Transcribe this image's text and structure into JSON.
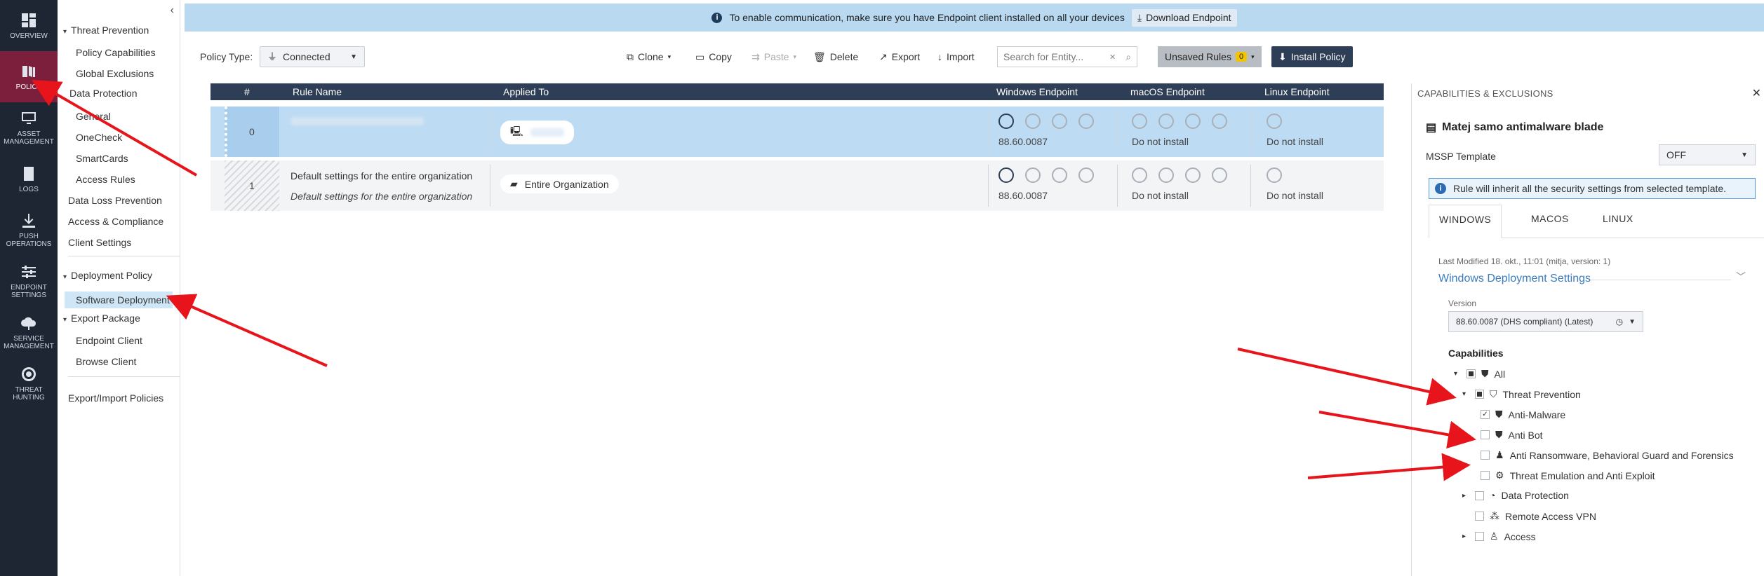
{
  "rail": [
    {
      "label": "OVERVIEW",
      "icon": "grid-icon"
    },
    {
      "label": "POLICY",
      "icon": "policy-icon",
      "active": true
    },
    {
      "label": "ASSET\nMANAGEMENT",
      "icon": "monitor-icon"
    },
    {
      "label": "LOGS",
      "icon": "logs-icon"
    },
    {
      "label": "PUSH\nOPERATIONS",
      "icon": "download-icon"
    },
    {
      "label": "ENDPOINT\nSETTINGS",
      "icon": "sliders-icon"
    },
    {
      "label": "SERVICE\nMANAGEMENT",
      "icon": "cloud-icon"
    },
    {
      "label": "THREAT\nHUNTING",
      "icon": "target-icon"
    }
  ],
  "nav": {
    "threat_prevention": "Threat Prevention",
    "policy_capabilities": "Policy Capabilities",
    "global_exclusions": "Global Exclusions",
    "data_protection": "Data Protection",
    "general": "General",
    "onecheck": "OneCheck",
    "smartcards": "SmartCards",
    "access_rules": "Access Rules",
    "dlp": "Data Loss Prevention",
    "access_compliance": "Access & Compliance",
    "client_settings": "Client Settings",
    "deployment_policy": "Deployment Policy",
    "software_deployment": "Software Deployment",
    "export_package": "Export Package",
    "endpoint_client": "Endpoint Client",
    "browse_client": "Browse Client",
    "export_import": "Export/Import Policies"
  },
  "banner": {
    "text": "To enable communication, make sure you have Endpoint client installed on all your devices",
    "download": "Download Endpoint"
  },
  "toolbar": {
    "policy_type_label": "Policy Type:",
    "policy_type_value": "Connected",
    "clone": "Clone",
    "copy": "Copy",
    "paste": "Paste",
    "delete": "Delete",
    "export": "Export",
    "import": "Import",
    "search_placeholder": "Search for Entity...",
    "unsaved": "Unsaved Rules",
    "unsaved_count": "0",
    "install": "Install Policy"
  },
  "table": {
    "headers": {
      "num": "#",
      "rule_name": "Rule Name",
      "applied_to": "Applied To",
      "windows": "Windows Endpoint",
      "macos": "macOS Endpoint",
      "linux": "Linux Endpoint"
    },
    "rows": [
      {
        "num": "0",
        "name": "",
        "desc": "",
        "applied": "",
        "win_version": "88.60.0087",
        "mac": "Do not install",
        "linux": "Do not install"
      },
      {
        "num": "1",
        "name": "Default settings for the entire organization",
        "desc": "Default settings for the entire organization",
        "applied": "Entire Organization",
        "win_version": "88.60.0087",
        "mac": "Do not install",
        "linux": "Do not install"
      }
    ]
  },
  "panel": {
    "title": "CAPABILITIES & EXCLUSIONS",
    "rule_name": "Matej samo antimalware blade",
    "mssp_label": "MSSP Template",
    "mssp_value": "OFF",
    "note": "Rule will inherit all the security settings from selected template.",
    "tabs": [
      "WINDOWS",
      "MACOS",
      "LINUX"
    ],
    "last_modified": "Last Modified 18. okt., 11:01 (mitja, version: 1)",
    "section": "Windows Deployment Settings",
    "version_label": "Version",
    "version_value": "88.60.0087 (DHS compliant) (Latest)",
    "capabilities_label": "Capabilities",
    "tree": [
      {
        "label": "All",
        "icon": "shield-icon"
      },
      {
        "label": "Threat Prevention",
        "icon": "shield-outline-icon"
      },
      {
        "label": "Anti-Malware",
        "icon": "shield-bug-icon",
        "checked": true
      },
      {
        "label": "Anti Bot",
        "icon": "shield-bot-icon"
      },
      {
        "label": "Anti Ransomware, Behavioral Guard and Forensics",
        "icon": "person-lock-icon"
      },
      {
        "label": "Threat Emulation and Anti Exploit",
        "icon": "gear-shield-icon"
      },
      {
        "label": "Data Protection",
        "icon": "data-protection-icon"
      },
      {
        "label": "Remote Access VPN",
        "icon": "vpn-icon"
      },
      {
        "label": "Access",
        "icon": "access-icon"
      }
    ]
  },
  "colors": {
    "rail_bg": "#1e2533",
    "rail_active": "#7c1f3c",
    "banner": "#b9d9f0",
    "header": "#2e3e57",
    "selected_row": "#bddbf3",
    "arrow": "#e8141b"
  }
}
